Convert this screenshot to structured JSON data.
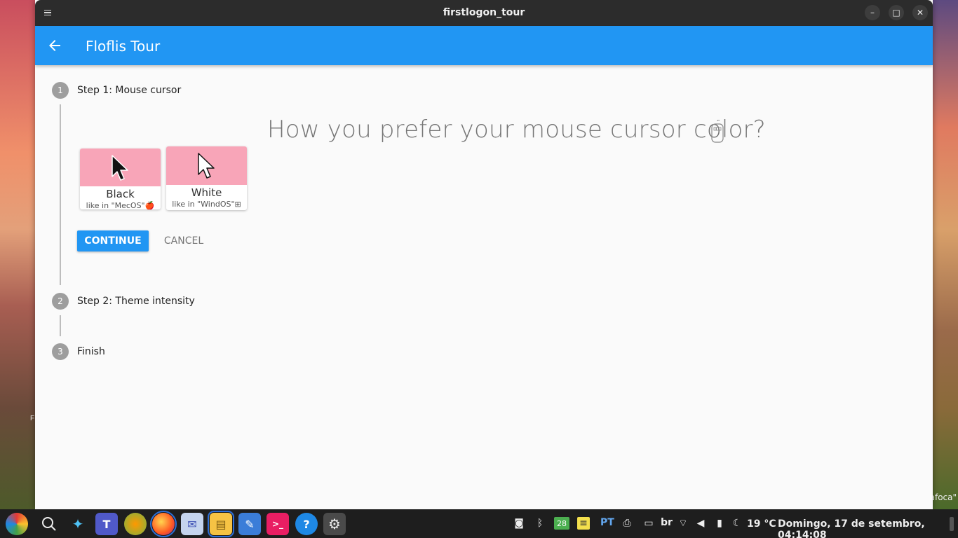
{
  "window": {
    "title": "firstlogon_tour"
  },
  "appbar": {
    "title": "Floflis Tour"
  },
  "steps": [
    {
      "number": "1",
      "label": "Step 1: Mouse cursor",
      "state": "active"
    },
    {
      "number": "2",
      "label": "Step 2: Theme intensity",
      "state": "inactive"
    },
    {
      "number": "3",
      "label": "Finish",
      "state": "inactive"
    }
  ],
  "question": {
    "text": "How you prefer your mouse cursor color?",
    "icon": "mouse-icon"
  },
  "options": [
    {
      "name": "Black",
      "subtitle": "like in \"MecOS\"🍎",
      "swatch_color": "#f8a5b8",
      "cursor_color": "black"
    },
    {
      "name": "White",
      "subtitle": "like in \"WindOS\"⊞",
      "swatch_color": "#f8a5b8",
      "cursor_color": "white"
    }
  ],
  "buttons": {
    "continue": "CONTINUE",
    "cancel": "CANCEL"
  },
  "desktop": {
    "caption": "afoca\"",
    "mark": "F"
  },
  "taskbar": {
    "apps": [
      {
        "name": "floflis-menu-icon",
        "glyph": "◐"
      },
      {
        "name": "search-icon",
        "glyph": "⌕"
      },
      {
        "name": "genie-icon",
        "glyph": "✦"
      },
      {
        "name": "teams-icon",
        "glyph": "T"
      },
      {
        "name": "planet-icon",
        "glyph": "🪐"
      },
      {
        "name": "firefox-icon",
        "glyph": "◉"
      },
      {
        "name": "mail-icon",
        "glyph": "✉"
      },
      {
        "name": "files-icon",
        "glyph": "▤"
      },
      {
        "name": "editor-icon",
        "glyph": "✎"
      },
      {
        "name": "terminal-icon",
        "glyph": ">_"
      },
      {
        "name": "help-icon",
        "glyph": "?"
      },
      {
        "name": "settings-icon",
        "glyph": "⚙"
      }
    ],
    "tray": {
      "calendar_day": "28",
      "language": "PT",
      "keyboard": "br",
      "temperature": "19 °C",
      "clock": "Domingo, 17 de setembro, 04:14:08"
    }
  },
  "colors": {
    "accent": "#2196f3",
    "step_inactive": "#9e9e9e",
    "titlebar": "#2c2c2c",
    "swatch": "#f8a5b8"
  }
}
